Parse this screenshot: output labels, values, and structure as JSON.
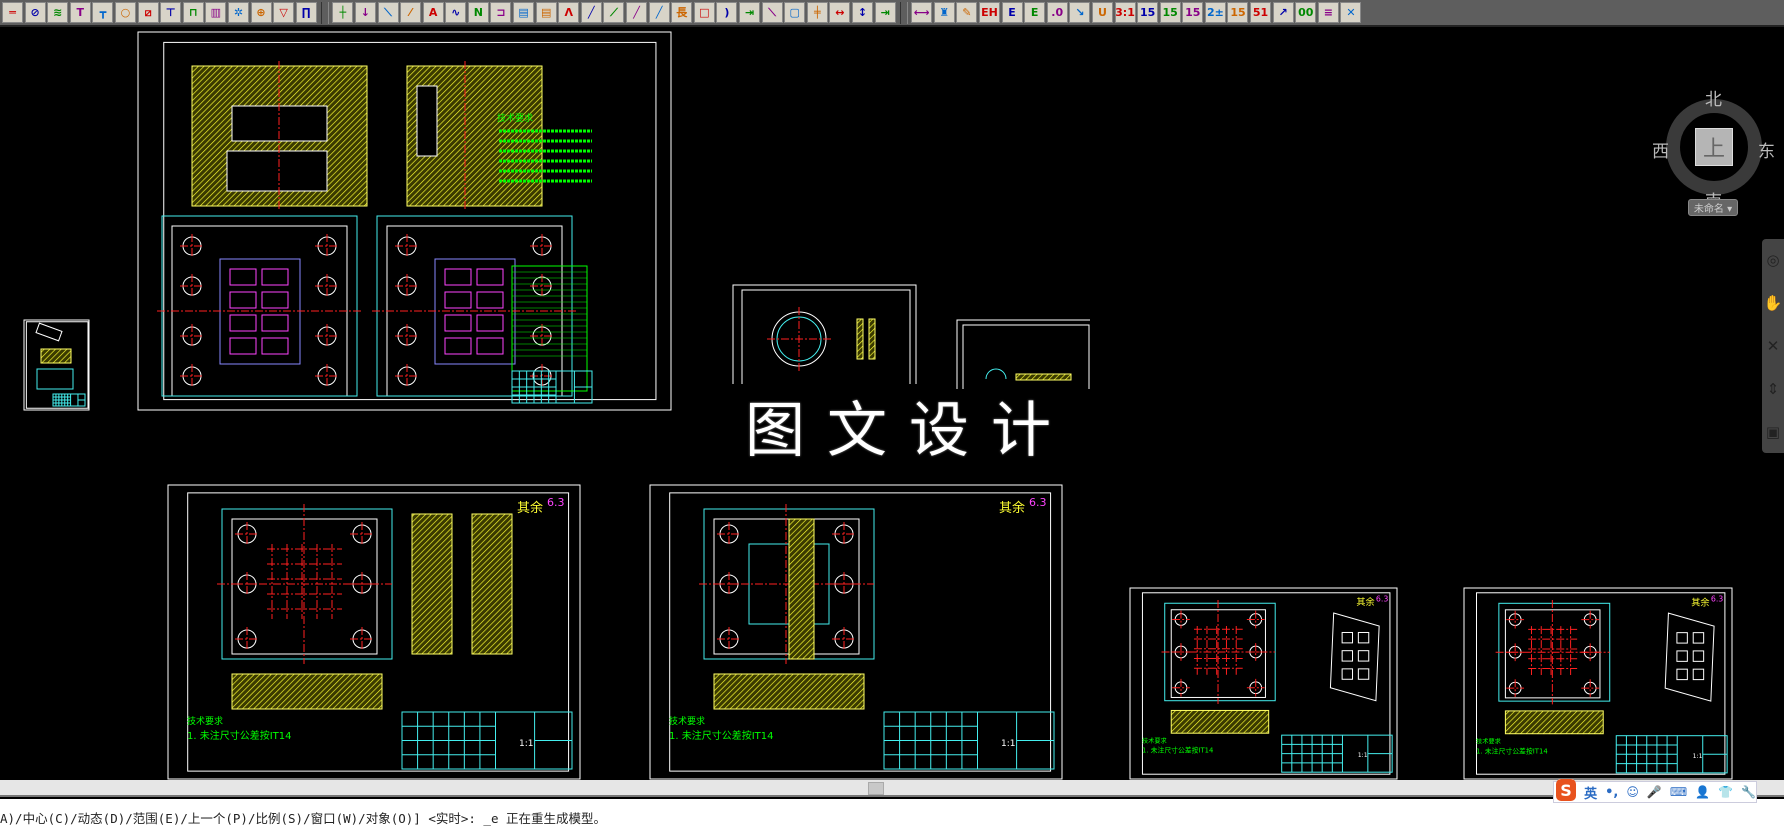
{
  "toolbar": {
    "groups": [
      [
        "shaft-icon",
        "section-circle-icon",
        "spring-icon",
        "screw-icon",
        "t-bolt-icon",
        "pin-icon",
        "hatch-icon",
        "bolt-icon",
        "bracket-icon",
        "bearing-icon",
        "gear-icon",
        "target-icon",
        "countersunk-icon",
        "bushing-icon"
      ],
      [
        "centerline-icon",
        "arrow-section-icon",
        "hatch-line-icon",
        "leader-icon",
        "section-label-icon",
        "curve-icon",
        "zigzag-icon",
        "break-icon",
        "color-fill-icon",
        "color-fill-2-icon",
        "angle-icon",
        "slash-icon",
        "double-hatch-icon",
        "line-icon",
        "line-2-icon",
        "long-icon",
        "radius-icon",
        "arc-icon",
        "align-icon",
        "point-line-icon",
        "rectangle-icon",
        "cross-line-icon",
        "dim-point-icon",
        "vertical-dim-icon",
        "offset-dim-icon"
      ],
      [
        "linear-dim-icon",
        "brush-icon",
        "eraser-icon",
        "eh-icon",
        "e-axis-icon",
        "e-fraction-icon",
        "zero-dim-icon",
        "ordinate-icon",
        "u-dim-icon",
        "ratio-dim-icon",
        "s-dim-icon",
        "dim-15-icon",
        "dim-15b-icon",
        "tolerance-dim-icon",
        "box-dim-icon",
        "reverse-dim-icon",
        "arrow-dim-icon",
        "multi-dim-icon",
        "stack-dim-icon",
        "delete-dim-icon"
      ]
    ]
  },
  "watermark": "图文设计",
  "viewcube": {
    "north": "北",
    "south": "南",
    "east": "东",
    "west": "西",
    "face": "上",
    "menu_label": "未命名 ▾"
  },
  "navbar": {
    "icons": [
      "steering-wheel-icon",
      "pan-icon",
      "zoom-extents-icon",
      "orbit-icon",
      "showmotion-icon"
    ]
  },
  "drawings": {
    "roughness_label": "其余",
    "roughness_value": "6.3",
    "scale": "1:1",
    "tolerance_note": "1. 未注尺寸公差按IT14",
    "tech_req": "技术要求"
  },
  "command": {
    "text": "A)/中心(C)/动态(D)/范围(E)/上一个(P)/比例(S)/窗口(W)/对象(O)] <实时>: _e 正在重生成模型。"
  },
  "ime": {
    "lang": "英",
    "punct": "•,",
    "icons": [
      "emoji-icon",
      "microphone-icon",
      "keyboard-icon",
      "user-icon",
      "skin-icon",
      "wrench-icon"
    ]
  }
}
